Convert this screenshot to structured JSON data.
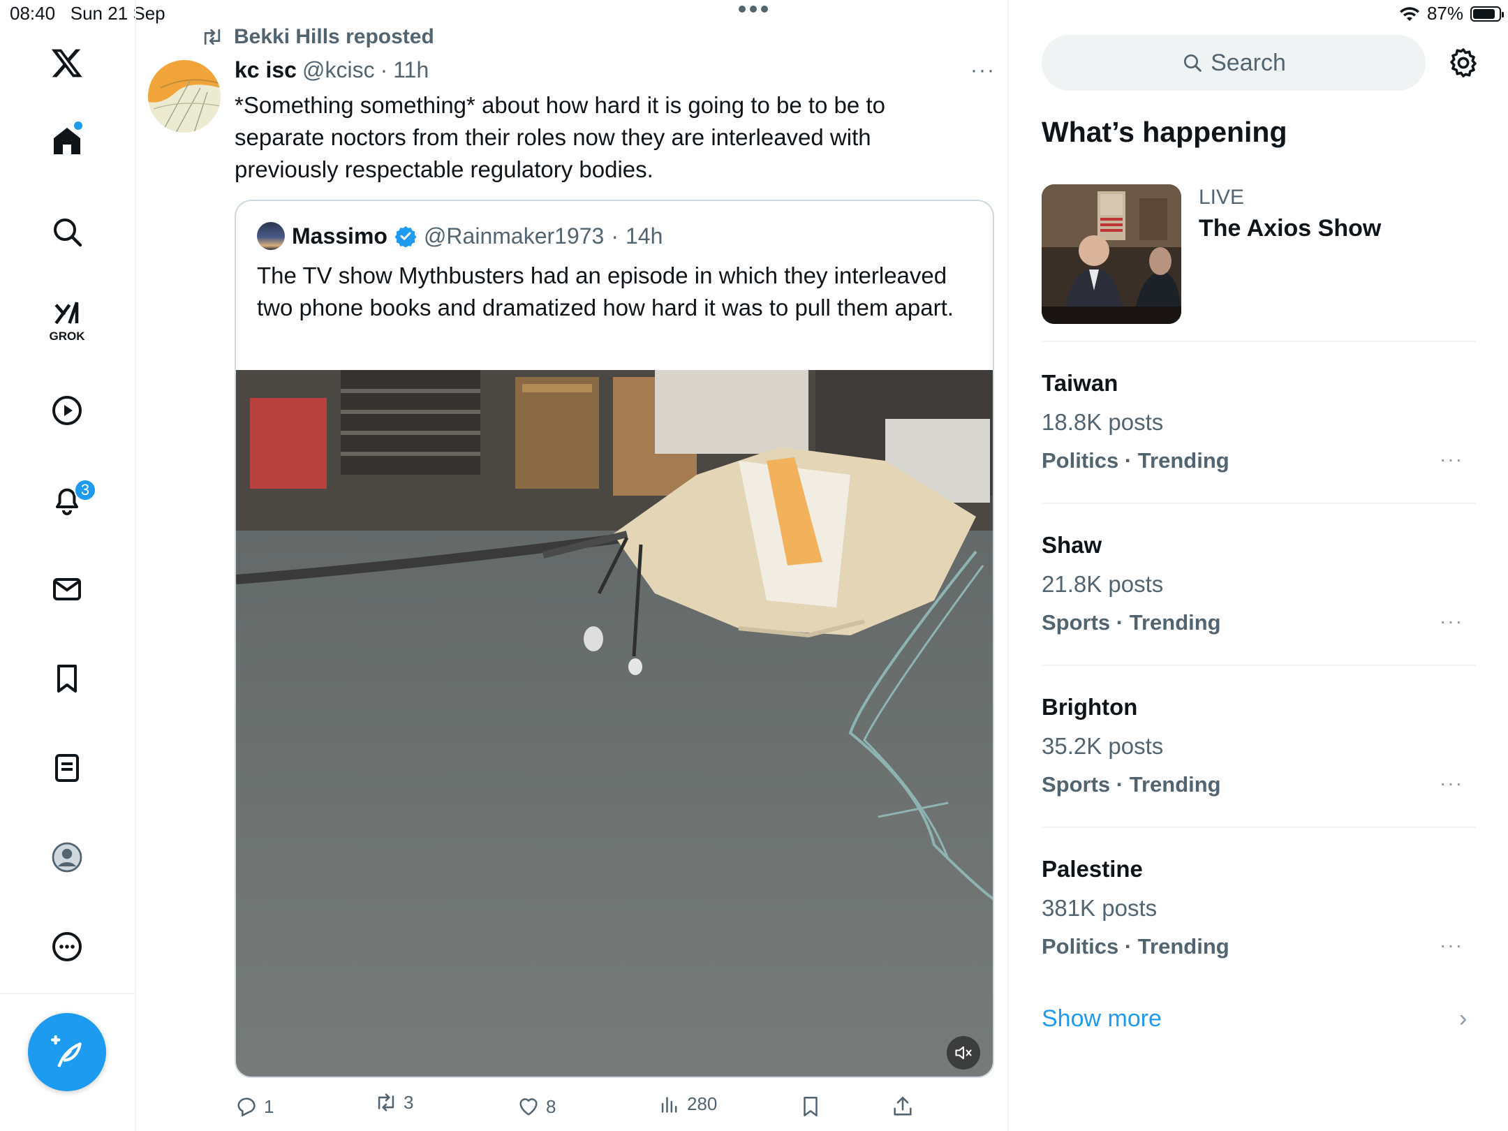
{
  "status_bar": {
    "time": "08:40",
    "date": "Sun 21 Sep",
    "battery": "87%",
    "battery_level": 0.87
  },
  "nav": {
    "notifications_badge": "3",
    "grok_label": "GROK",
    "items": [
      "home-icon",
      "search-icon",
      "grok-icon",
      "video-icon",
      "notifications-icon",
      "messages-icon",
      "bookmarks-icon",
      "lists-icon",
      "profile-icon",
      "more-icon"
    ]
  },
  "tweet": {
    "repost_label": "Bekki Hills reposted",
    "author_name": "kc isc",
    "author_handle": "@kcisc",
    "dot": "·",
    "time": "11h",
    "more": "···",
    "text": "*Something something* about how hard it is going to be to be to separate noctors from their roles now they are interleaved with previously respectable regulatory bodies.",
    "quote": {
      "author_name": "Massimo",
      "author_handle": "@Rainmaker1973",
      "dot": "·",
      "time": "14h",
      "text": "The TV show Mythbusters had an episode in which they interleaved two phone books and dramatized how hard it was to pull them apart."
    },
    "actions": {
      "replies": "1",
      "reposts": "3",
      "likes": "8",
      "views": "280"
    }
  },
  "sidebar": {
    "search_placeholder": "Search",
    "section_title": "What’s happening",
    "live": {
      "label": "LIVE",
      "title": "The Axios Show"
    },
    "trends": [
      {
        "name": "Taiwan",
        "posts": "18.8K posts",
        "category": "Politics · Trending"
      },
      {
        "name": "Shaw",
        "posts": "21.8K posts",
        "category": "Sports · Trending"
      },
      {
        "name": "Brighton",
        "posts": "35.2K posts",
        "category": "Sports · Trending"
      },
      {
        "name": "Palestine",
        "posts": "381K posts",
        "category": "Politics · Trending"
      }
    ],
    "trend_more": "···",
    "show_more": "Show more",
    "show_more_chevron": "›"
  },
  "colors": {
    "accent": "#1d9bf0",
    "text": "#0f1419",
    "muted": "#536471",
    "border": "#eff3f4"
  }
}
